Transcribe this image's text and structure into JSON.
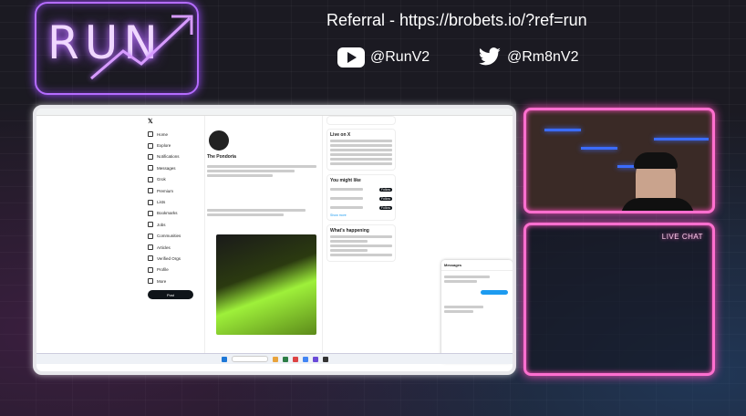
{
  "logo": {
    "text": "RUN"
  },
  "referral": {
    "text": "Referral - https://brobets.io/?ref=run"
  },
  "socials": [
    {
      "icon": "youtube-icon",
      "handle": "@RunV2"
    },
    {
      "icon": "twitter-icon",
      "handle": "@Rm8nV2"
    }
  ],
  "screen": {
    "nav_items": [
      "Home",
      "Explore",
      "Notifications",
      "Messages",
      "Grok",
      "Premium",
      "Lists",
      "Bookmarks",
      "Jobs",
      "Communities",
      "Articles",
      "Verified Orgs",
      "Profile",
      "More"
    ],
    "post_label": "Post",
    "profile_name": "The Pondoria",
    "side_titles": [
      "Live on X",
      "You might like",
      "What's happening"
    ],
    "show_more": "Show more",
    "follow_label": "Follow",
    "dm_title": "Messages"
  },
  "chat": {
    "label": "LIVE CHAT"
  },
  "colors": {
    "neon_pink": "#ff6fcf",
    "neon_purple": "#b56cff",
    "background": "#1b1a22"
  }
}
